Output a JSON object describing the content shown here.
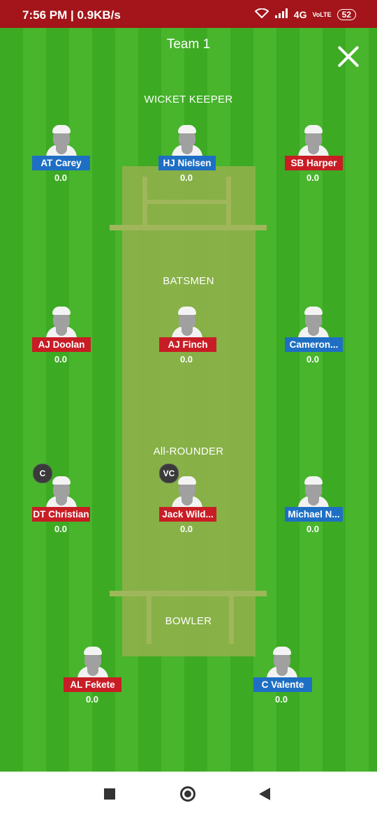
{
  "status": {
    "left_text": "7:56 PM | 0.9KB/s",
    "network": "4G",
    "volte": "VoLTE",
    "battery": "52"
  },
  "header": {
    "title": "Team 1"
  },
  "sections": {
    "wicket_keeper": "WICKET KEEPER",
    "batsmen": "BATSMEN",
    "all_rounder": "All-ROUNDER",
    "bowler": "BOWLER"
  },
  "players": {
    "wk1": {
      "name": "AT Carey",
      "points": "0.0",
      "team_color": "#1e6fc4"
    },
    "wk2": {
      "name": "HJ Nielsen",
      "points": "0.0",
      "team_color": "#1e6fc4"
    },
    "wk3": {
      "name": "SB Harper",
      "points": "0.0",
      "team_color": "#c81d25"
    },
    "bat1": {
      "name": "AJ Doolan",
      "points": "0.0",
      "team_color": "#c81d25"
    },
    "bat2": {
      "name": "AJ Finch",
      "points": "0.0",
      "team_color": "#c81d25"
    },
    "bat3": {
      "name": "Cameron...",
      "points": "0.0",
      "team_color": "#1e6fc4"
    },
    "ar1": {
      "name": "DT Christian",
      "points": "0.0",
      "team_color": "#c81d25",
      "badge": "C"
    },
    "ar2": {
      "name": "Jack Wild...",
      "points": "0.0",
      "team_color": "#c81d25",
      "badge": "VC"
    },
    "ar3": {
      "name": "Michael N...",
      "points": "0.0",
      "team_color": "#1e6fc4"
    },
    "bowl1": {
      "name": "AL Fekete",
      "points": "0.0",
      "team_color": "#c81d25"
    },
    "bowl2": {
      "name": "C Valente",
      "points": "0.0",
      "team_color": "#1e6fc4"
    }
  },
  "icons": {
    "close": "close-icon",
    "avatar": "player-avatar-icon",
    "nav_recents": "square-icon",
    "nav_home": "circle-icon",
    "nav_back": "triangle-back-icon"
  }
}
